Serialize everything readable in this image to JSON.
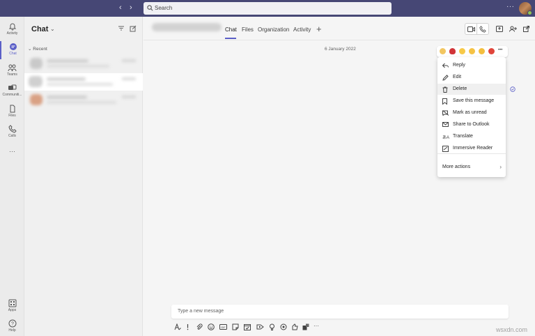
{
  "search": {
    "placeholder": "Search"
  },
  "nav": {
    "back": "‹",
    "forward": "›"
  },
  "topbar": {
    "more": "···"
  },
  "rail": {
    "items": [
      {
        "label": "Activity",
        "icon": "bell-icon"
      },
      {
        "label": "Chat",
        "icon": "chat-icon"
      },
      {
        "label": "Teams",
        "icon": "teams-icon"
      },
      {
        "label": "Communiti...",
        "icon": "communities-icon"
      },
      {
        "label": "Files",
        "icon": "files-icon"
      },
      {
        "label": "Calls",
        "icon": "phone-icon"
      }
    ],
    "more": "···",
    "apps": "Apps",
    "help": "Help"
  },
  "chatpanel": {
    "title": "Chat",
    "chevron": "⌄",
    "recent": "Recent",
    "recent_chev": "⌄"
  },
  "header": {
    "tabs": [
      {
        "label": "Chat",
        "active": true
      },
      {
        "label": "Files",
        "active": false
      },
      {
        "label": "Organization",
        "active": false
      },
      {
        "label": "Activity",
        "active": false
      }
    ],
    "add": "+"
  },
  "conversation": {
    "date": "6 January 2022"
  },
  "reactions": [
    "like",
    "heart",
    "laugh",
    "surprised",
    "sad",
    "angry"
  ],
  "reaction_more": "•••",
  "context_menu": {
    "items": [
      {
        "label": "Reply",
        "icon": "reply-icon"
      },
      {
        "label": "Edit",
        "icon": "pencil-icon"
      },
      {
        "label": "Delete",
        "icon": "trash-icon"
      },
      {
        "label": "Save this message",
        "icon": "bookmark-icon"
      },
      {
        "label": "Mark as unread",
        "icon": "mark-unread-icon"
      },
      {
        "label": "Share to Outlook",
        "icon": "mail-icon"
      },
      {
        "label": "Translate",
        "icon": "translate-icon"
      },
      {
        "label": "Immersive Reader",
        "icon": "immersive-reader-icon"
      }
    ],
    "more_actions": "More actions",
    "more_chevron": "›"
  },
  "compose": {
    "placeholder": "Type a new message"
  },
  "colors": {
    "accent": "#5b5fc7",
    "topbar": "#464775",
    "presence": "#92c353"
  },
  "watermark": "wsxdn.com"
}
